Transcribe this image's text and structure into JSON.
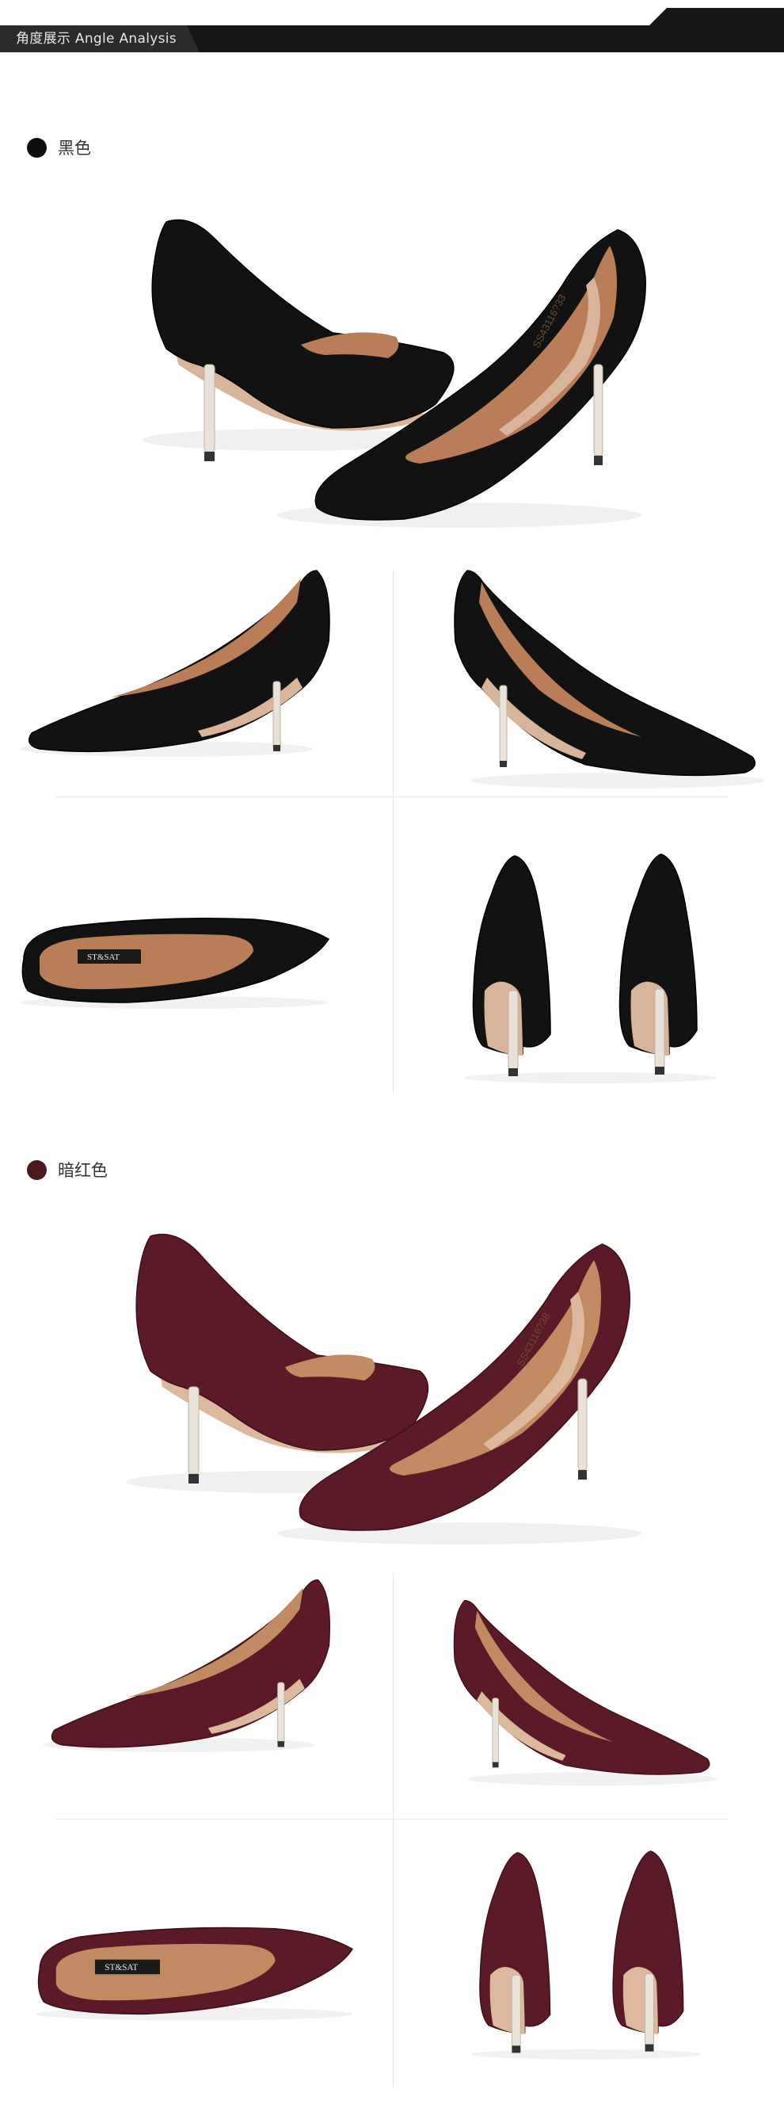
{
  "header": {
    "title": "角度展示  Angle Analysis"
  },
  "sections": [
    {
      "label": "黑色",
      "color": "#0e0e0e",
      "suede": "#121212",
      "suede_edge": "#000000",
      "lining": "#b97d58",
      "sole": "#d8b59a"
    },
    {
      "label": "暗红色",
      "color": "#4b1820",
      "suede": "#5a1a27",
      "suede_edge": "#3d0f18",
      "lining": "#c08a62",
      "sole": "#dcb89c"
    }
  ],
  "insole_brand": "ST&SAT",
  "insole_codes": {
    "black": "SS43116?33\n10 ?20?3",
    "wine": "SS43116?38\n37 ?20?3"
  },
  "icons": {
    "section_dot": "filled-circle"
  }
}
